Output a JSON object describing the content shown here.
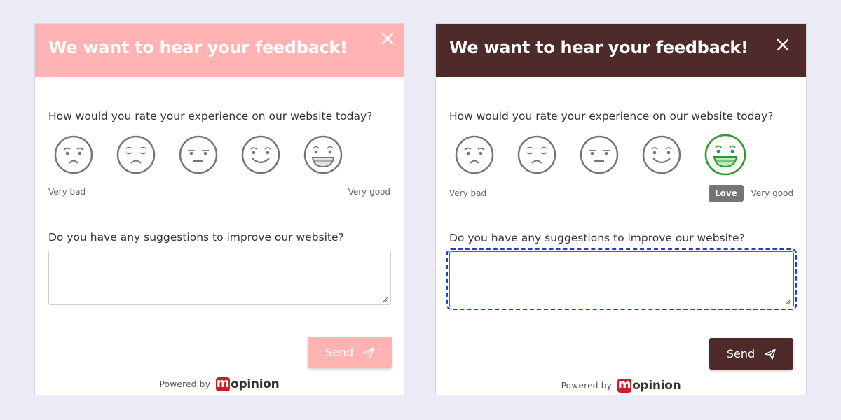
{
  "colors": {
    "page_bg": "#ebebf8",
    "left_accent": "#ffb3b3",
    "right_accent": "#4e2a2a",
    "selected_face": "#2e9a2e",
    "brand_red": "#cc1d2b"
  },
  "left": {
    "title": "We want to hear your feedback!",
    "question1": "How would you rate your experience on our website today?",
    "scale_low": "Very bad",
    "scale_high": "Very good",
    "question2": "Do you have any suggestions to improve our website?",
    "textarea_value": "",
    "send_label": "Send",
    "powered_by": "Powered by",
    "brand": "opinion",
    "brand_mark": "m"
  },
  "right": {
    "title": "We want to hear your feedback!",
    "question1": "How would you rate your experience on our website today?",
    "scale_low": "Very bad",
    "scale_high": "Very good",
    "tooltip": "Love",
    "selected_rating": 5,
    "question2": "Do you have any suggestions to improve our website?",
    "textarea_value": "",
    "send_label": "Send",
    "powered_by": "Powered by",
    "brand": "opinion",
    "brand_mark": "m"
  },
  "faces": [
    "very-bad-face-icon",
    "bad-face-icon",
    "neutral-face-icon",
    "good-face-icon",
    "love-face-icon"
  ]
}
